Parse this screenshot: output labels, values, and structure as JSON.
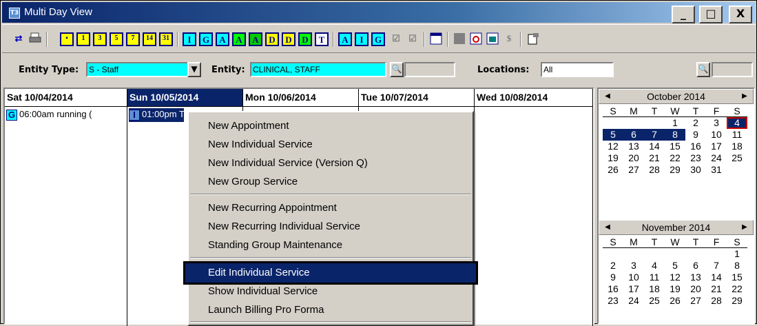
{
  "window": {
    "title": "Multi Day View",
    "app_icon": "T3",
    "buttons": [
      "_",
      "□",
      "X"
    ]
  },
  "toolbar": {
    "refresh_icon": "⇄",
    "print_icon": "print-icon",
    "cal_days": [
      "1",
      "3",
      "5",
      "7",
      "14",
      "31"
    ],
    "letters1": [
      "I",
      "G",
      "A",
      "A",
      "A",
      "D",
      "D",
      "D",
      "T"
    ],
    "letters2": [
      "A",
      "I",
      "G"
    ]
  },
  "filters": {
    "entity_type_label": "Entity Type:",
    "entity_type_value": "S - Staff",
    "entity_label": "Entity:",
    "entity_value": "CLINICAL, STAFF",
    "locations_label": "Locations:",
    "locations_value": "All"
  },
  "days": [
    {
      "label": "Sat 10/04/2014"
    },
    {
      "label": "Sun 10/05/2014"
    },
    {
      "label": "Mon 10/06/2014"
    },
    {
      "label": "Tue 10/07/2014"
    },
    {
      "label": "Wed 10/08/2014"
    }
  ],
  "appointments": [
    {
      "badge": "G",
      "text": "06:00am running ("
    },
    {
      "badge": "I",
      "text": "01:00pm TEST, TE"
    }
  ],
  "context_menu": {
    "items": [
      "New Appointment",
      "New Individual Service",
      "New Individual Service (Version Q)",
      "New Group Service",
      "New Recurring Appointment",
      "New Recurring Individual Service",
      "Standing Group Maintenance",
      "Edit Individual Service",
      "Show Individual Service",
      "Launch Billing Pro Forma"
    ],
    "selected": "Edit Individual Service"
  },
  "calendars": [
    {
      "month": "October 2014",
      "weekdays": [
        "S",
        "M",
        "T",
        "W",
        "T",
        "F",
        "S"
      ],
      "cells": [
        "",
        "",
        "",
        "1",
        "2",
        "3",
        "4",
        "5",
        "6",
        "7",
        "8",
        "9",
        "10",
        "11",
        "12",
        "13",
        "14",
        "15",
        "16",
        "17",
        "18",
        "19",
        "20",
        "21",
        "22",
        "23",
        "24",
        "25",
        "26",
        "27",
        "28",
        "29",
        "30",
        "31"
      ]
    },
    {
      "month": "November 2014",
      "weekdays": [
        "S",
        "M",
        "T",
        "W",
        "T",
        "F",
        "S"
      ],
      "cells": [
        "",
        "",
        "",
        "",
        "",
        "",
        "1",
        "2",
        "3",
        "4",
        "5",
        "6",
        "7",
        "8",
        "9",
        "10",
        "11",
        "12",
        "13",
        "14",
        "15",
        "16",
        "17",
        "18",
        "19",
        "20",
        "21",
        "22",
        "23",
        "24",
        "25",
        "26",
        "27",
        "28",
        "29"
      ]
    }
  ]
}
